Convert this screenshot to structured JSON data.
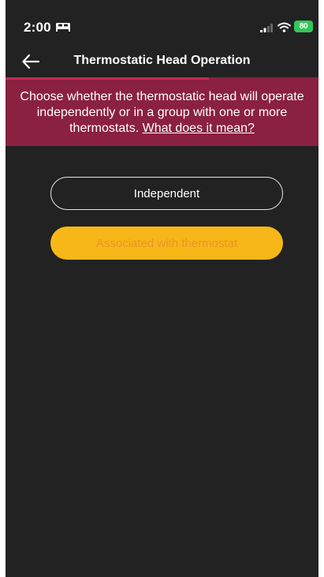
{
  "status_bar": {
    "time": "2:00",
    "battery_level": "80",
    "icons": [
      "bed-icon",
      "cellular-signal-icon",
      "wifi-icon",
      "battery-icon"
    ],
    "battery_color": "#35c759"
  },
  "header": {
    "back_icon": "arrow-left-icon",
    "title": "Thermostatic Head Operation",
    "progress": 0.65
  },
  "banner": {
    "text": "Choose whether the thermostatic head will operate independently or in a group with one or more thermostats.",
    "link_text": "What does it mean?",
    "background": "#8a2140"
  },
  "options": {
    "independent_label": "Independent",
    "associated_label": "Associated with thermostat",
    "accent": "#f7b718"
  },
  "colors": {
    "background": "#222222",
    "accent": "#f7b718",
    "banner": "#8a2140"
  }
}
